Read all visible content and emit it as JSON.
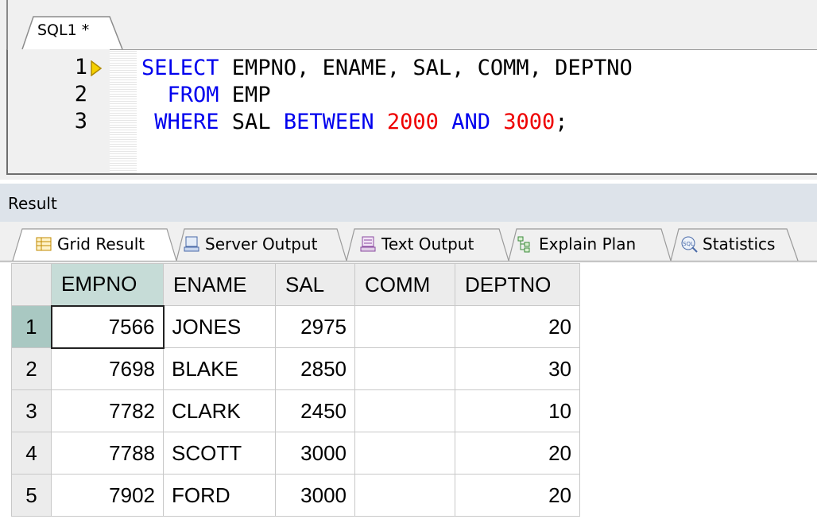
{
  "editor": {
    "tab_label": "SQL1 *",
    "line_numbers": [
      "1",
      "2",
      "3"
    ],
    "lines": [
      [
        {
          "t": "SELECT",
          "c": "kw"
        },
        {
          "t": " EMPNO, ENAME, SAL, COMM, DEPTNO",
          "c": "id"
        }
      ],
      [
        {
          "t": "  FROM",
          "c": "kw"
        },
        {
          "t": " EMP",
          "c": "id"
        }
      ],
      [
        {
          "t": " WHERE",
          "c": "kw"
        },
        {
          "t": " SAL ",
          "c": "id"
        },
        {
          "t": "BETWEEN",
          "c": "kw"
        },
        {
          "t": " ",
          "c": "id"
        },
        {
          "t": "2000",
          "c": "num"
        },
        {
          "t": " ",
          "c": "id"
        },
        {
          "t": "AND",
          "c": "kw"
        },
        {
          "t": " ",
          "c": "id"
        },
        {
          "t": "3000",
          "c": "num"
        },
        {
          "t": ";",
          "c": "id"
        }
      ]
    ]
  },
  "result": {
    "title": "Result",
    "tabs": [
      "Grid Result",
      "Server Output",
      "Text Output",
      "Explain Plan",
      "Statistics"
    ],
    "icons": [
      "grid-result-icon",
      "server-output-icon",
      "text-output-icon",
      "explain-plan-icon",
      "statistics-icon"
    ]
  },
  "grid": {
    "columns": [
      "EMPNO",
      "ENAME",
      "SAL",
      "COMM",
      "DEPTNO"
    ],
    "rows": [
      {
        "n": "1",
        "EMPNO": "7566",
        "ENAME": "JONES",
        "SAL": "2975",
        "COMM": "",
        "DEPTNO": "20"
      },
      {
        "n": "2",
        "EMPNO": "7698",
        "ENAME": "BLAKE",
        "SAL": "2850",
        "COMM": "",
        "DEPTNO": "30"
      },
      {
        "n": "3",
        "EMPNO": "7782",
        "ENAME": "CLARK",
        "SAL": "2450",
        "COMM": "",
        "DEPTNO": "10"
      },
      {
        "n": "4",
        "EMPNO": "7788",
        "ENAME": "SCOTT",
        "SAL": "3000",
        "COMM": "",
        "DEPTNO": "20"
      },
      {
        "n": "5",
        "EMPNO": "7902",
        "ENAME": "FORD",
        "SAL": "3000",
        "COMM": "",
        "DEPTNO": "20"
      }
    ]
  },
  "colors": {
    "keyword": "#0000ee",
    "number": "#ee0000",
    "selected_header": "#c6dcd7",
    "selected_row_number": "#a9c8c2",
    "exec_arrow": "#f5d000"
  }
}
